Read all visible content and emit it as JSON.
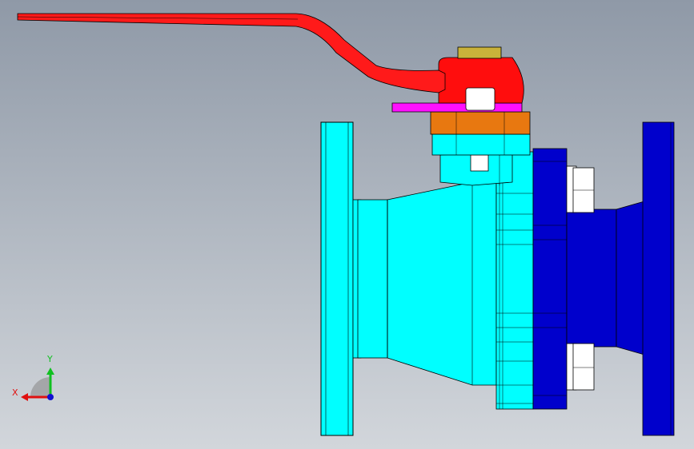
{
  "triad": {
    "x_label": "X",
    "y_label": "Y",
    "x_color": "#e01010",
    "y_color": "#10c020",
    "z_color": "#1010d0"
  },
  "colors": {
    "handle": "#ff1a1a",
    "bonnet_cap": "#ff0d0d",
    "stem_nut": "#c9b23a",
    "stop_plate": "#ff10ff",
    "gland_flange": "#e87810",
    "body": "#00ffff",
    "end_cap": "#0000cc",
    "bolts": "#ffffff",
    "edges": "#000000"
  }
}
